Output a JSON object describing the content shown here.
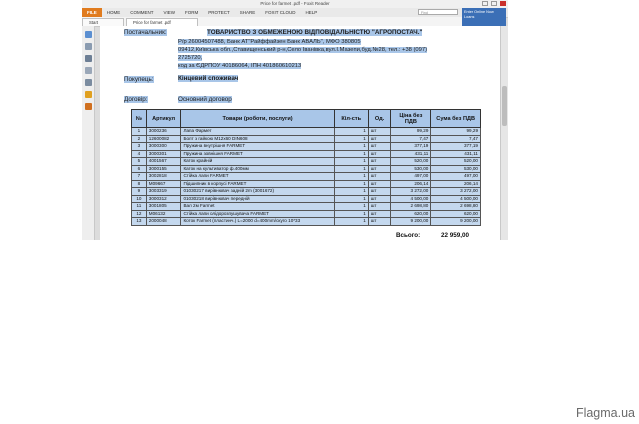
{
  "window": {
    "title": "Price for farmet .pdf - Foxit Reader"
  },
  "ribbon": {
    "file": "FILE",
    "menus": [
      "HOME",
      "COMMENT",
      "VIEW",
      "FORM",
      "PROTECT",
      "SHARE",
      "FOXIT CLOUD",
      "HELP"
    ],
    "search_placeholder": "Find",
    "promo": "Enter Online Now Loans"
  },
  "tabs": [
    "Start",
    "Price for farmet .pdf"
  ],
  "document": {
    "supplier_label": "Постачальник:",
    "supplier_name": "ТОВАРИСТВО З ОБМЕЖЕНОЮ ВІДПОВІДАЛЬНІСТЮ \"АГРОПОСТАЧ.\"",
    "supplier_line1": "Р/р 26004507488, Банк АТ\"Райффайзен Банк АВАЛЬ\", МФО 380805",
    "supplier_line2": "09412,Київська обл.,Ставищенський р-н,Село Іванівка,вул.І.Мазепи,буд.№28, тел.: +38 (097)",
    "supplier_line3": "2725720,",
    "supplier_line4": "код за ЄДРПОУ 40186064, ІПН 401860610213",
    "buyer_label": "Покупець:",
    "buyer_value": "Кінцевий споживач",
    "contract_label": "Договір:",
    "contract_value": "Основний договор",
    "table_headers": [
      "№",
      "Артикул",
      "Товари (роботи, послуги)",
      "Кіл-сть",
      "Од.",
      "Ціна без ПДВ",
      "Сума без ПДВ"
    ],
    "rows": [
      {
        "n": "1",
        "art": "3000236",
        "name": "Лапа Фармет",
        "qty": "1",
        "unit": "шт",
        "price": "99,29",
        "sum": "99,29"
      },
      {
        "n": "2",
        "art": "12600082",
        "name": "Болт з гайкою М12х60 DIN608",
        "qty": "1",
        "unit": "шт",
        "price": "7,47",
        "sum": "7,47"
      },
      {
        "n": "3",
        "art": "3000300",
        "name": "Пружина внутрішня FARMET",
        "qty": "1",
        "unit": "шт",
        "price": "377,19",
        "sum": "377,19"
      },
      {
        "n": "4",
        "art": "3000301",
        "name": "Пружина зовнішня FARMET",
        "qty": "1",
        "unit": "шт",
        "price": "431,11",
        "sum": "431,11"
      },
      {
        "n": "5",
        "art": "4001567",
        "name": "Каток крайній",
        "qty": "1",
        "unit": "шт",
        "price": "520,00",
        "sum": "520,00"
      },
      {
        "n": "6",
        "art": "3000155",
        "name": "Каток на культиватор ф.400мм",
        "qty": "1",
        "unit": "шт",
        "price": "530,00",
        "sum": "530,00"
      },
      {
        "n": "7",
        "art": "3002818",
        "name": "Стійка лапи FARMET",
        "qty": "1",
        "unit": "шт",
        "price": "497,00",
        "sum": "497,00"
      },
      {
        "n": "8",
        "art": "M09667",
        "name": "Підшипник в корпусі FARMET",
        "qty": "1",
        "unit": "шт",
        "price": "206,14",
        "sum": "206,14"
      },
      {
        "n": "9",
        "art": "3003319",
        "name": "01030217 вирівнювач задній 2m (3001672)",
        "qty": "1",
        "unit": "шт",
        "price": "3 272,00",
        "sum": "3 272,00"
      },
      {
        "n": "10",
        "art": "3000312",
        "name": "01030218 вирівнювач передній",
        "qty": "1",
        "unit": "шт",
        "price": "4 500,00",
        "sum": "4 500,00"
      },
      {
        "n": "11",
        "art": "3001805",
        "name": "Вал 2м Farmet",
        "qty": "1",
        "unit": "шт",
        "price": "2 698,80",
        "sum": "2 698,80"
      },
      {
        "n": "12",
        "art": "M06132",
        "name": "Стійка лапи олідорозпушувача FARMET",
        "qty": "1",
        "unit": "шт",
        "price": "620,00",
        "sum": "620,00"
      },
      {
        "n": "13",
        "art": "2000048",
        "name": "Коток Farmet (пластинч.) L=2000 d=400mm/скуго 10*33",
        "qty": "1",
        "unit": "шт",
        "price": "9 200,00",
        "sum": "9 200,00"
      }
    ],
    "total_label": "Всього:",
    "total_value": "22 959,00"
  },
  "watermark": "Flagma.ua",
  "colors": {
    "highlight": "#a9c6e8",
    "file_tab": "#e07b1e",
    "promo": "#3b6fb6"
  }
}
